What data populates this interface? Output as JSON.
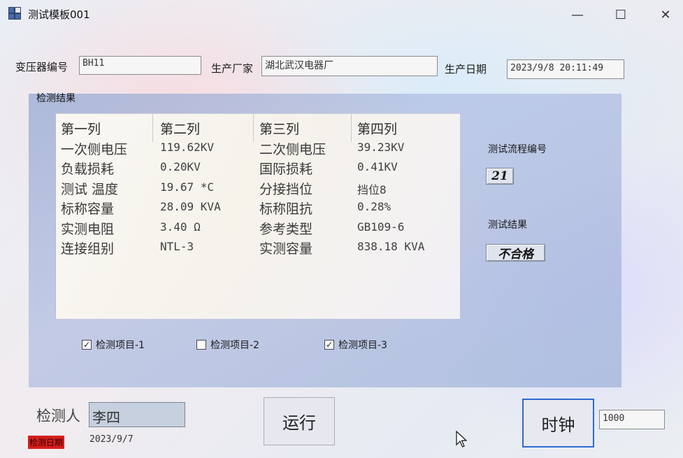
{
  "window": {
    "title": "测试模板001",
    "controls": {
      "minimize": "—",
      "maximize": "☐",
      "close": "✕"
    }
  },
  "header": {
    "transformer_label": "变压器编号",
    "transformer_value": "BH11",
    "manufacturer_label": "生产厂家",
    "manufacturer_value": "湖北武汉电器厂",
    "date_label": "生产日期",
    "date_value": "2023/9/8 20:11:49"
  },
  "results_group": {
    "title": "检测结果",
    "columns": [
      "第一列",
      "第二列",
      "第三列",
      "第四列"
    ],
    "rows": [
      [
        "一次侧电压",
        "119.62KV",
        "二次侧电压",
        "39.23KV"
      ],
      [
        "负载损耗",
        "0.20KV",
        "国际损耗",
        "0.41KV"
      ],
      [
        "测试 温度",
        "19.67 *C",
        "分接挡位",
        "挡位8"
      ],
      [
        "标称容量",
        "28.09 KVA",
        "标称阻抗",
        "0.28%"
      ],
      [
        "实测电阻",
        "3.40 Ω",
        "参考类型",
        "GB109-6"
      ],
      [
        "连接组别",
        "NTL-3",
        "实测容量",
        "838.18 KVA"
      ]
    ],
    "flow_label": "测试流程编号",
    "flow_value": "21",
    "result_label": "测试结果",
    "result_value": "不合格",
    "checkboxes": [
      {
        "label": "检测项目-1",
        "checked": true
      },
      {
        "label": "检测项目-2",
        "checked": false
      },
      {
        "label": "检测项目-3",
        "checked": true
      }
    ]
  },
  "footer": {
    "inspector_label": "检测人",
    "inspector_value": "李四",
    "run_button": "运行",
    "clock_button": "时钟",
    "clock_value": "1000",
    "date_tag": "检测日期",
    "date_value": "2023/9/7"
  },
  "colors": {
    "group_bg": "#9cb0d8",
    "focus_border": "#2f6bd0",
    "date_tag_bg": "#d81e1e"
  }
}
